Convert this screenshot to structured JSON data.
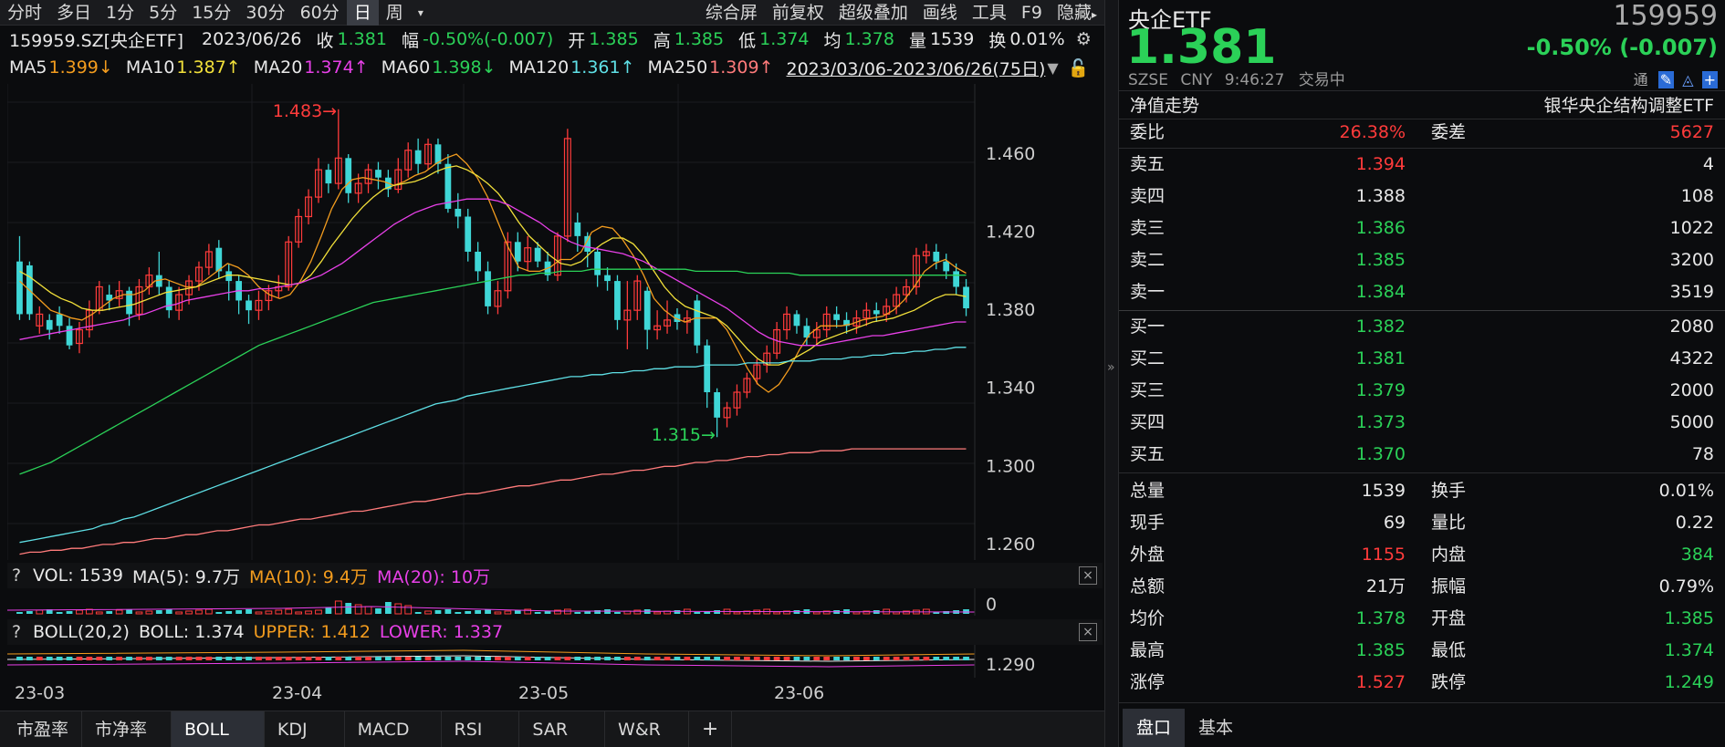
{
  "toolbar": {
    "items": [
      "分时",
      "多日",
      "1分",
      "5分",
      "15分",
      "30分",
      "60分",
      "日",
      "周"
    ],
    "active": "日",
    "dropdown_icon": "chevron-down",
    "right_items": [
      "综合屏",
      "前复权",
      "超级叠加",
      "画线",
      "工具",
      "F9",
      "隐藏"
    ]
  },
  "info": {
    "code_name": "159959.SZ[央企ETF]",
    "date": "2023/06/26",
    "close_label": "收",
    "close": "1.381",
    "change_label": "幅",
    "change": "-0.50%(-0.007)",
    "open_label": "开",
    "open": "1.385",
    "high_label": "高",
    "high": "1.385",
    "low_label": "低",
    "low": "1.374",
    "avg_label": "均",
    "avg": "1.378",
    "vol_label": "量",
    "vol": "1539",
    "turn_label": "换",
    "turn": "0.01%"
  },
  "ma": {
    "ma5": {
      "label": "MA5",
      "value": "1.399↓",
      "color": "#f39c1e"
    },
    "ma10": {
      "label": "MA10",
      "value": "1.387↑",
      "color": "#f2e03a"
    },
    "ma20": {
      "label": "MA20",
      "value": "1.374↑",
      "color": "#e840e8"
    },
    "ma60": {
      "label": "MA60",
      "value": "1.398↓",
      "color": "#2bd158"
    },
    "ma120": {
      "label": "MA120",
      "value": "1.361↑",
      "color": "#5fe0e6"
    },
    "ma250": {
      "label": "MA250",
      "value": "1.309↑",
      "color": "#ff7b7b"
    },
    "range": "2023/03/06-2023/06/26(75日)"
  },
  "chart_data": {
    "type": "candlestick",
    "y_ticks": [
      "1.460",
      "1.420",
      "1.380",
      "1.340",
      "1.300",
      "1.260"
    ],
    "ylim": [
      1.252,
      1.496
    ],
    "x_labels": [
      "23-03",
      "23-04",
      "23-05",
      "23-06"
    ],
    "annotations": [
      {
        "text": "1.483",
        "value": 1.483
      },
      {
        "text": "1.315",
        "value": 1.315
      }
    ],
    "candles": [
      [
        1.405,
        1.378,
        1.418,
        1.375
      ],
      [
        1.403,
        1.378,
        1.405,
        1.375
      ],
      [
        1.372,
        1.378,
        1.382,
        1.368
      ],
      [
        1.375,
        1.37,
        1.378,
        1.365
      ],
      [
        1.378,
        1.372,
        1.382,
        1.368
      ],
      [
        1.372,
        1.362,
        1.376,
        1.36
      ],
      [
        1.363,
        1.37,
        1.374,
        1.358
      ],
      [
        1.37,
        1.38,
        1.385,
        1.366
      ],
      [
        1.38,
        1.392,
        1.395,
        1.378
      ],
      [
        1.388,
        1.385,
        1.393,
        1.38
      ],
      [
        1.386,
        1.39,
        1.395,
        1.382
      ],
      [
        1.39,
        1.378,
        1.392,
        1.372
      ],
      [
        1.378,
        1.392,
        1.396,
        1.375
      ],
      [
        1.392,
        1.398,
        1.402,
        1.388
      ],
      [
        1.398,
        1.392,
        1.41,
        1.388
      ],
      [
        1.392,
        1.38,
        1.395,
        1.376
      ],
      [
        1.38,
        1.388,
        1.392,
        1.375
      ],
      [
        1.388,
        1.395,
        1.398,
        1.383
      ],
      [
        1.395,
        1.402,
        1.405,
        1.39
      ],
      [
        1.402,
        1.41,
        1.414,
        1.398
      ],
      [
        1.412,
        1.4,
        1.416,
        1.396
      ],
      [
        1.4,
        1.395,
        1.404,
        1.385
      ],
      [
        1.395,
        1.385,
        1.398,
        1.378
      ],
      [
        1.385,
        1.38,
        1.388,
        1.373
      ],
      [
        1.38,
        1.385,
        1.39,
        1.375
      ],
      [
        1.385,
        1.39,
        1.393,
        1.38
      ],
      [
        1.39,
        1.392,
        1.398,
        1.386
      ],
      [
        1.392,
        1.415,
        1.418,
        1.39
      ],
      [
        1.415,
        1.428,
        1.432,
        1.412
      ],
      [
        1.428,
        1.438,
        1.442,
        1.424
      ],
      [
        1.438,
        1.452,
        1.458,
        1.435
      ],
      [
        1.452,
        1.445,
        1.455,
        1.44
      ],
      [
        1.445,
        1.458,
        1.483,
        1.442
      ],
      [
        1.458,
        1.44,
        1.46,
        1.435
      ],
      [
        1.44,
        1.445,
        1.45,
        1.435
      ],
      [
        1.445,
        1.452,
        1.455,
        1.44
      ],
      [
        1.452,
        1.448,
        1.456,
        1.442
      ],
      [
        1.448,
        1.442,
        1.452,
        1.438
      ],
      [
        1.442,
        1.452,
        1.458,
        1.44
      ],
      [
        1.452,
        1.462,
        1.466,
        1.448
      ],
      [
        1.462,
        1.455,
        1.468,
        1.45
      ],
      [
        1.455,
        1.465,
        1.468,
        1.452
      ],
      [
        1.465,
        1.455,
        1.468,
        1.45
      ],
      [
        1.455,
        1.432,
        1.46,
        1.43
      ],
      [
        1.432,
        1.428,
        1.44,
        1.422
      ],
      [
        1.428,
        1.41,
        1.432,
        1.405
      ],
      [
        1.41,
        1.4,
        1.415,
        1.395
      ],
      [
        1.4,
        1.382,
        1.405,
        1.378
      ],
      [
        1.382,
        1.39,
        1.395,
        1.378
      ],
      [
        1.39,
        1.415,
        1.42,
        1.386
      ],
      [
        1.415,
        1.405,
        1.42,
        1.4
      ],
      [
        1.405,
        1.412,
        1.418,
        1.4
      ],
      [
        1.412,
        1.405,
        1.415,
        1.402
      ],
      [
        1.405,
        1.398,
        1.41,
        1.395
      ],
      [
        1.398,
        1.418,
        1.42,
        1.395
      ],
      [
        1.418,
        1.468,
        1.473,
        1.415
      ],
      [
        1.425,
        1.418,
        1.43,
        1.41
      ],
      [
        1.418,
        1.41,
        1.42,
        1.402
      ],
      [
        1.41,
        1.398,
        1.412,
        1.392
      ],
      [
        1.398,
        1.395,
        1.402,
        1.39
      ],
      [
        1.395,
        1.375,
        1.398,
        1.37
      ],
      [
        1.375,
        1.38,
        1.395,
        1.36
      ],
      [
        1.38,
        1.395,
        1.398,
        1.375
      ],
      [
        1.39,
        1.37,
        1.392,
        1.36
      ],
      [
        1.37,
        1.372,
        1.38,
        1.365
      ],
      [
        1.372,
        1.375,
        1.385,
        1.368
      ],
      [
        1.378,
        1.374,
        1.381,
        1.37
      ],
      [
        1.374,
        1.376,
        1.38,
        1.368
      ],
      [
        1.385,
        1.362,
        1.388,
        1.358
      ],
      [
        1.362,
        1.338,
        1.365,
        1.33
      ],
      [
        1.338,
        1.325,
        1.34,
        1.315
      ],
      [
        1.325,
        1.33,
        1.333,
        1.32
      ],
      [
        1.33,
        1.338,
        1.342,
        1.326
      ],
      [
        1.338,
        1.345,
        1.348,
        1.335
      ],
      [
        1.345,
        1.352,
        1.355,
        1.342
      ],
      [
        1.352,
        1.358,
        1.362,
        1.348
      ],
      [
        1.358,
        1.37,
        1.374,
        1.355
      ],
      [
        1.37,
        1.378,
        1.382,
        1.365
      ],
      [
        1.378,
        1.372,
        1.38,
        1.368
      ],
      [
        1.372,
        1.366,
        1.376,
        1.362
      ]
    ],
    "closes_extra": [
      1.37,
      1.378,
      1.375,
      1.372,
      1.376,
      1.38,
      1.378,
      1.382,
      1.388,
      1.392,
      1.408,
      1.41,
      1.405,
      1.4,
      1.392,
      1.381
    ],
    "ma_lines": {
      "ma5": [
        1.395,
        1.39,
        1.385,
        1.38,
        1.378,
        1.376,
        1.375,
        1.378,
        1.382,
        1.386,
        1.388,
        1.388,
        1.39,
        1.395,
        1.396,
        1.394,
        1.392,
        1.392,
        1.396,
        1.4,
        1.404,
        1.402,
        1.398,
        1.392,
        1.388,
        1.386,
        1.388,
        1.395,
        1.405,
        1.418,
        1.432,
        1.442,
        1.447,
        1.448,
        1.447,
        1.446,
        1.444,
        1.446,
        1.449,
        1.451,
        1.455,
        1.458,
        1.46,
        1.455,
        1.448,
        1.438,
        1.425,
        1.412,
        1.402,
        1.4,
        1.4,
        1.402,
        1.406,
        1.406,
        1.41,
        1.42,
        1.423,
        1.422,
        1.416,
        1.408,
        1.398,
        1.386,
        1.38,
        1.376,
        1.374,
        1.376,
        1.376,
        1.376,
        1.37,
        1.36,
        1.35,
        1.342,
        1.338,
        1.342,
        1.35,
        1.36,
        1.368,
        1.372,
        1.372,
        1.372,
        1.373,
        1.375,
        1.376,
        1.377,
        1.38,
        1.385,
        1.392,
        1.4,
        1.404,
        1.406,
        1.402,
        1.399
      ],
      "ma10": [
        1.4,
        1.397,
        1.393,
        1.389,
        1.386,
        1.384,
        1.381,
        1.38,
        1.38,
        1.381,
        1.382,
        1.383,
        1.385,
        1.387,
        1.389,
        1.39,
        1.391,
        1.392,
        1.394,
        1.396,
        1.398,
        1.398,
        1.397,
        1.396,
        1.395,
        1.394,
        1.393,
        1.394,
        1.398,
        1.405,
        1.413,
        1.42,
        1.427,
        1.433,
        1.438,
        1.442,
        1.444,
        1.445,
        1.446,
        1.448,
        1.451,
        1.453,
        1.454,
        1.452,
        1.449,
        1.445,
        1.44,
        1.433,
        1.425,
        1.418,
        1.413,
        1.408,
        1.404,
        1.403,
        1.405,
        1.41,
        1.414,
        1.417,
        1.417,
        1.414,
        1.408,
        1.4,
        1.392,
        1.386,
        1.382,
        1.38,
        1.378,
        1.376,
        1.372,
        1.366,
        1.36,
        1.355,
        1.352,
        1.352,
        1.354,
        1.357,
        1.36,
        1.364,
        1.366,
        1.368,
        1.37,
        1.372,
        1.374,
        1.375,
        1.376,
        1.378,
        1.38,
        1.383,
        1.386,
        1.388,
        1.388,
        1.387
      ],
      "ma20": [
        1.365,
        1.366,
        1.367,
        1.368,
        1.369,
        1.37,
        1.371,
        1.372,
        1.373,
        1.374,
        1.375,
        1.377,
        1.378,
        1.38,
        1.382,
        1.383,
        1.385,
        1.386,
        1.387,
        1.388,
        1.389,
        1.39,
        1.39,
        1.391,
        1.391,
        1.392,
        1.393,
        1.394,
        1.396,
        1.398,
        1.401,
        1.404,
        1.408,
        1.412,
        1.416,
        1.42,
        1.424,
        1.427,
        1.43,
        1.432,
        1.434,
        1.435,
        1.436,
        1.437,
        1.437,
        1.437,
        1.436,
        1.434,
        1.431,
        1.428,
        1.425,
        1.421,
        1.418,
        1.415,
        1.413,
        1.412,
        1.411,
        1.41,
        1.409,
        1.407,
        1.405,
        1.402,
        1.399,
        1.396,
        1.393,
        1.39,
        1.387,
        1.384,
        1.381,
        1.377,
        1.373,
        1.369,
        1.366,
        1.364,
        1.363,
        1.362,
        1.362,
        1.362,
        1.363,
        1.364,
        1.365,
        1.366,
        1.367,
        1.367,
        1.368,
        1.369,
        1.37,
        1.371,
        1.372,
        1.373,
        1.374,
        1.374
      ],
      "ma60": [
        1.296,
        1.298,
        1.3,
        1.302,
        1.305,
        1.308,
        1.311,
        1.314,
        1.317,
        1.32,
        1.323,
        1.326,
        1.329,
        1.332,
        1.335,
        1.338,
        1.341,
        1.344,
        1.347,
        1.35,
        1.353,
        1.356,
        1.359,
        1.362,
        1.364,
        1.366,
        1.368,
        1.37,
        1.372,
        1.374,
        1.376,
        1.378,
        1.38,
        1.382,
        1.384,
        1.385,
        1.386,
        1.387,
        1.388,
        1.389,
        1.39,
        1.391,
        1.392,
        1.393,
        1.394,
        1.395,
        1.396,
        1.397,
        1.398,
        1.398,
        1.399,
        1.399,
        1.4,
        1.4,
        1.4,
        1.401,
        1.401,
        1.401,
        1.401,
        1.401,
        1.401,
        1.401,
        1.401,
        1.401,
        1.401,
        1.4,
        1.4,
        1.4,
        1.4,
        1.4,
        1.399,
        1.399,
        1.399,
        1.399,
        1.399,
        1.398,
        1.398,
        1.398,
        1.398,
        1.398,
        1.398,
        1.398,
        1.398,
        1.398,
        1.398,
        1.398,
        1.398,
        1.398,
        1.398,
        1.398,
        1.398,
        1.398
      ],
      "ma120": [
        1.261,
        1.262,
        1.263,
        1.264,
        1.265,
        1.266,
        1.267,
        1.268,
        1.27,
        1.271,
        1.273,
        1.274,
        1.276,
        1.278,
        1.28,
        1.282,
        1.284,
        1.286,
        1.288,
        1.29,
        1.292,
        1.294,
        1.296,
        1.298,
        1.3,
        1.302,
        1.304,
        1.306,
        1.308,
        1.31,
        1.312,
        1.314,
        1.316,
        1.318,
        1.32,
        1.322,
        1.324,
        1.326,
        1.328,
        1.33,
        1.332,
        1.333,
        1.334,
        1.336,
        1.337,
        1.338,
        1.339,
        1.34,
        1.341,
        1.342,
        1.343,
        1.344,
        1.345,
        1.346,
        1.346,
        1.347,
        1.347,
        1.348,
        1.348,
        1.349,
        1.349,
        1.35,
        1.35,
        1.351,
        1.351,
        1.351,
        1.352,
        1.352,
        1.352,
        1.352,
        1.353,
        1.353,
        1.353,
        1.353,
        1.354,
        1.354,
        1.354,
        1.355,
        1.355,
        1.355,
        1.356,
        1.356,
        1.357,
        1.357,
        1.358,
        1.358,
        1.359,
        1.359,
        1.36,
        1.36,
        1.361,
        1.361
      ],
      "ma250": [
        1.255,
        1.256,
        1.256,
        1.257,
        1.257,
        1.258,
        1.258,
        1.259,
        1.26,
        1.26,
        1.261,
        1.261,
        1.262,
        1.263,
        1.263,
        1.264,
        1.265,
        1.265,
        1.266,
        1.267,
        1.267,
        1.268,
        1.269,
        1.27,
        1.27,
        1.271,
        1.272,
        1.273,
        1.273,
        1.274,
        1.275,
        1.276,
        1.277,
        1.277,
        1.278,
        1.279,
        1.28,
        1.281,
        1.282,
        1.282,
        1.283,
        1.284,
        1.285,
        1.286,
        1.286,
        1.287,
        1.288,
        1.289,
        1.29,
        1.29,
        1.291,
        1.292,
        1.293,
        1.293,
        1.294,
        1.295,
        1.296,
        1.296,
        1.297,
        1.298,
        1.298,
        1.299,
        1.3,
        1.3,
        1.301,
        1.302,
        1.302,
        1.303,
        1.303,
        1.304,
        1.305,
        1.305,
        1.306,
        1.306,
        1.307,
        1.307,
        1.307,
        1.308,
        1.308,
        1.308,
        1.309,
        1.309,
        1.309,
        1.309,
        1.309,
        1.309,
        1.309,
        1.309,
        1.309,
        1.309,
        1.309,
        1.309
      ]
    },
    "volume_zero_label": "0",
    "boll_tick": "1.290"
  },
  "vol": {
    "qmark": "?",
    "vol": "VOL: 1539",
    "ma5": "MA(5): 9.7万",
    "ma10": "MA(10): 9.4万",
    "ma20": "MA(20): 10万",
    "close": "×"
  },
  "boll": {
    "qmark": "?",
    "name": "BOLL(20,2)",
    "boll": "BOLL: 1.374",
    "upper": "UPPER: 1.412",
    "lower": "LOWER: 1.337",
    "close": "×"
  },
  "bottom_tabs": [
    "市盈率",
    "市净率",
    "BOLL",
    "KDJ",
    "MACD",
    "RSI",
    "SAR",
    "W&R"
  ],
  "bottom_active": "BOLL",
  "add_tab": "+",
  "quote": {
    "name": "央企ETF",
    "code": "159959",
    "price": "1.381",
    "change": "-0.50% (-0.007)",
    "exchange": "SZSE",
    "currency": "CNY",
    "time": "9:46:27",
    "status": "交易中",
    "tong": "通",
    "nav_label": "净值走势",
    "fund_name": "银华央企结构调整ETF",
    "weibi_label": "委比",
    "weibi": "26.38%",
    "weicha_label": "委差",
    "weicha": "5627",
    "asks": [
      {
        "label": "卖五",
        "price": "1.394",
        "vol": "4",
        "color": "red"
      },
      {
        "label": "卖四",
        "price": "1.388",
        "vol": "108",
        "color": "white"
      },
      {
        "label": "卖三",
        "price": "1.386",
        "vol": "1022",
        "color": "green"
      },
      {
        "label": "卖二",
        "price": "1.385",
        "vol": "3200",
        "color": "green"
      },
      {
        "label": "卖一",
        "price": "1.384",
        "vol": "3519",
        "color": "green"
      }
    ],
    "bids": [
      {
        "label": "买一",
        "price": "1.382",
        "vol": "2080",
        "color": "green"
      },
      {
        "label": "买二",
        "price": "1.381",
        "vol": "4322",
        "color": "green"
      },
      {
        "label": "买三",
        "price": "1.379",
        "vol": "2000",
        "color": "green"
      },
      {
        "label": "买四",
        "price": "1.373",
        "vol": "5000",
        "color": "green"
      },
      {
        "label": "买五",
        "price": "1.370",
        "vol": "78",
        "color": "green"
      }
    ],
    "stats": [
      {
        "l1": "总量",
        "v1": "1539",
        "c1": "white",
        "l2": "换手",
        "v2": "0.01%",
        "c2": "white"
      },
      {
        "l1": "现手",
        "v1": "69",
        "c1": "white",
        "l2": "量比",
        "v2": "0.22",
        "c2": "white"
      },
      {
        "l1": "外盘",
        "v1": "1155",
        "c1": "red",
        "l2": "内盘",
        "v2": "384",
        "c2": "green"
      },
      {
        "l1": "总额",
        "v1": "21万",
        "c1": "white",
        "l2": "振幅",
        "v2": "0.79%",
        "c2": "white"
      },
      {
        "l1": "均价",
        "v1": "1.378",
        "c1": "green",
        "l2": "开盘",
        "v2": "1.385",
        "c2": "green"
      },
      {
        "l1": "最高",
        "v1": "1.385",
        "c1": "green",
        "l2": "最低",
        "v2": "1.374",
        "c2": "green"
      },
      {
        "l1": "涨停",
        "v1": "1.527",
        "c1": "red",
        "l2": "跌停",
        "v2": "1.249",
        "c2": "green"
      }
    ],
    "tabs": [
      "盘口",
      "基本"
    ],
    "tab_active": "盘口"
  }
}
